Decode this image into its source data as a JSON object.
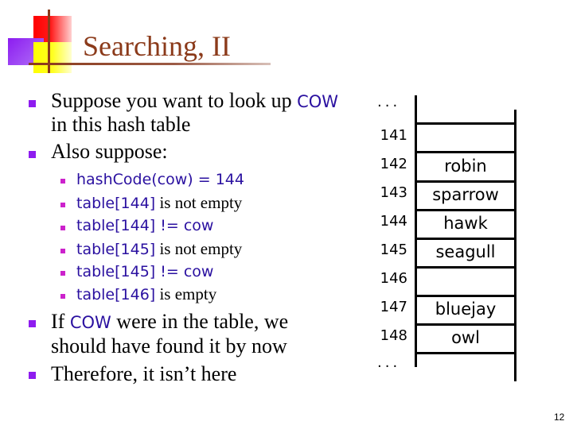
{
  "slide": {
    "title": "Searching, II",
    "page_number": "12"
  },
  "bullets": {
    "b1": {
      "pre": "Suppose you want to look up ",
      "code": "COW",
      "line2": "in this hash table"
    },
    "b2": {
      "text": "Also suppose:"
    },
    "sub": [
      {
        "code": "hashCode(cow) = 144",
        "text": ""
      },
      {
        "code": "table[144]",
        "text": " is not empty"
      },
      {
        "code": "table[144] != cow",
        "text": ""
      },
      {
        "code": "table[145]",
        "text": " is not empty"
      },
      {
        "code": "table[145] != cow",
        "text": ""
      },
      {
        "code": "table[146]",
        "text": " is empty"
      }
    ],
    "b3": {
      "pre": "If ",
      "code": "COW",
      "post": " were in the table, we",
      "line2": "should have found it by now"
    },
    "b4": {
      "text": "Therefore, it isn’t here"
    }
  },
  "hash_table": {
    "ellipsis_top": "...",
    "ellipsis_bottom": "...",
    "rows": [
      {
        "index": "141",
        "value": ""
      },
      {
        "index": "142",
        "value": "robin"
      },
      {
        "index": "143",
        "value": "sparrow"
      },
      {
        "index": "144",
        "value": "hawk"
      },
      {
        "index": "145",
        "value": "seagull"
      },
      {
        "index": "146",
        "value": ""
      },
      {
        "index": "147",
        "value": "bluejay"
      },
      {
        "index": "148",
        "value": "owl"
      }
    ]
  },
  "colors": {
    "title": "#8b3a1a",
    "bullet_l1": "#8e1cef",
    "bullet_l2": "#cc22cc",
    "code_text": "#2a10a0"
  }
}
